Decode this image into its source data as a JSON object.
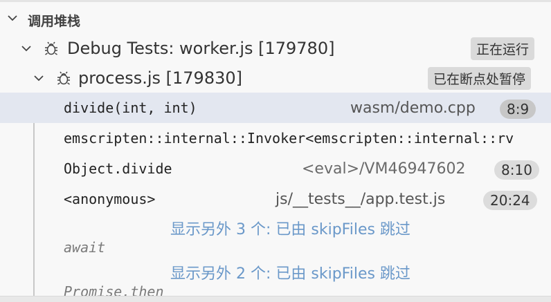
{
  "section": {
    "title": "调用堆栈"
  },
  "sessions": [
    {
      "label": "Debug Tests: worker.js [179780]",
      "status": "正在运行"
    },
    {
      "label": "process.js [179830]",
      "status": "已在断点处暂停"
    }
  ],
  "frames": [
    {
      "name": "divide(int, int)",
      "source": "wasm/demo.cpp",
      "line": "8:9"
    },
    {
      "name": "emscripten::internal::Invoker<emscripten::internal::rv",
      "source": "",
      "line": ""
    },
    {
      "name": "Object.divide",
      "source": "<eval>/VM46947602",
      "line": "8:10"
    },
    {
      "name": "<anonymous>",
      "source": "js/__tests__/app.test.js",
      "line": "20:24"
    }
  ],
  "skipped": [
    {
      "label": "显示另外 3 个: 已由 skipFiles 跳过"
    },
    {
      "label": "显示另外 2 个: 已由 skipFiles 跳过"
    }
  ],
  "async_labels": [
    "await",
    "Promise.then"
  ],
  "colors": {
    "selected_row": "#e3e7f0",
    "link": "#6a98c9",
    "badge": "#dadada"
  }
}
